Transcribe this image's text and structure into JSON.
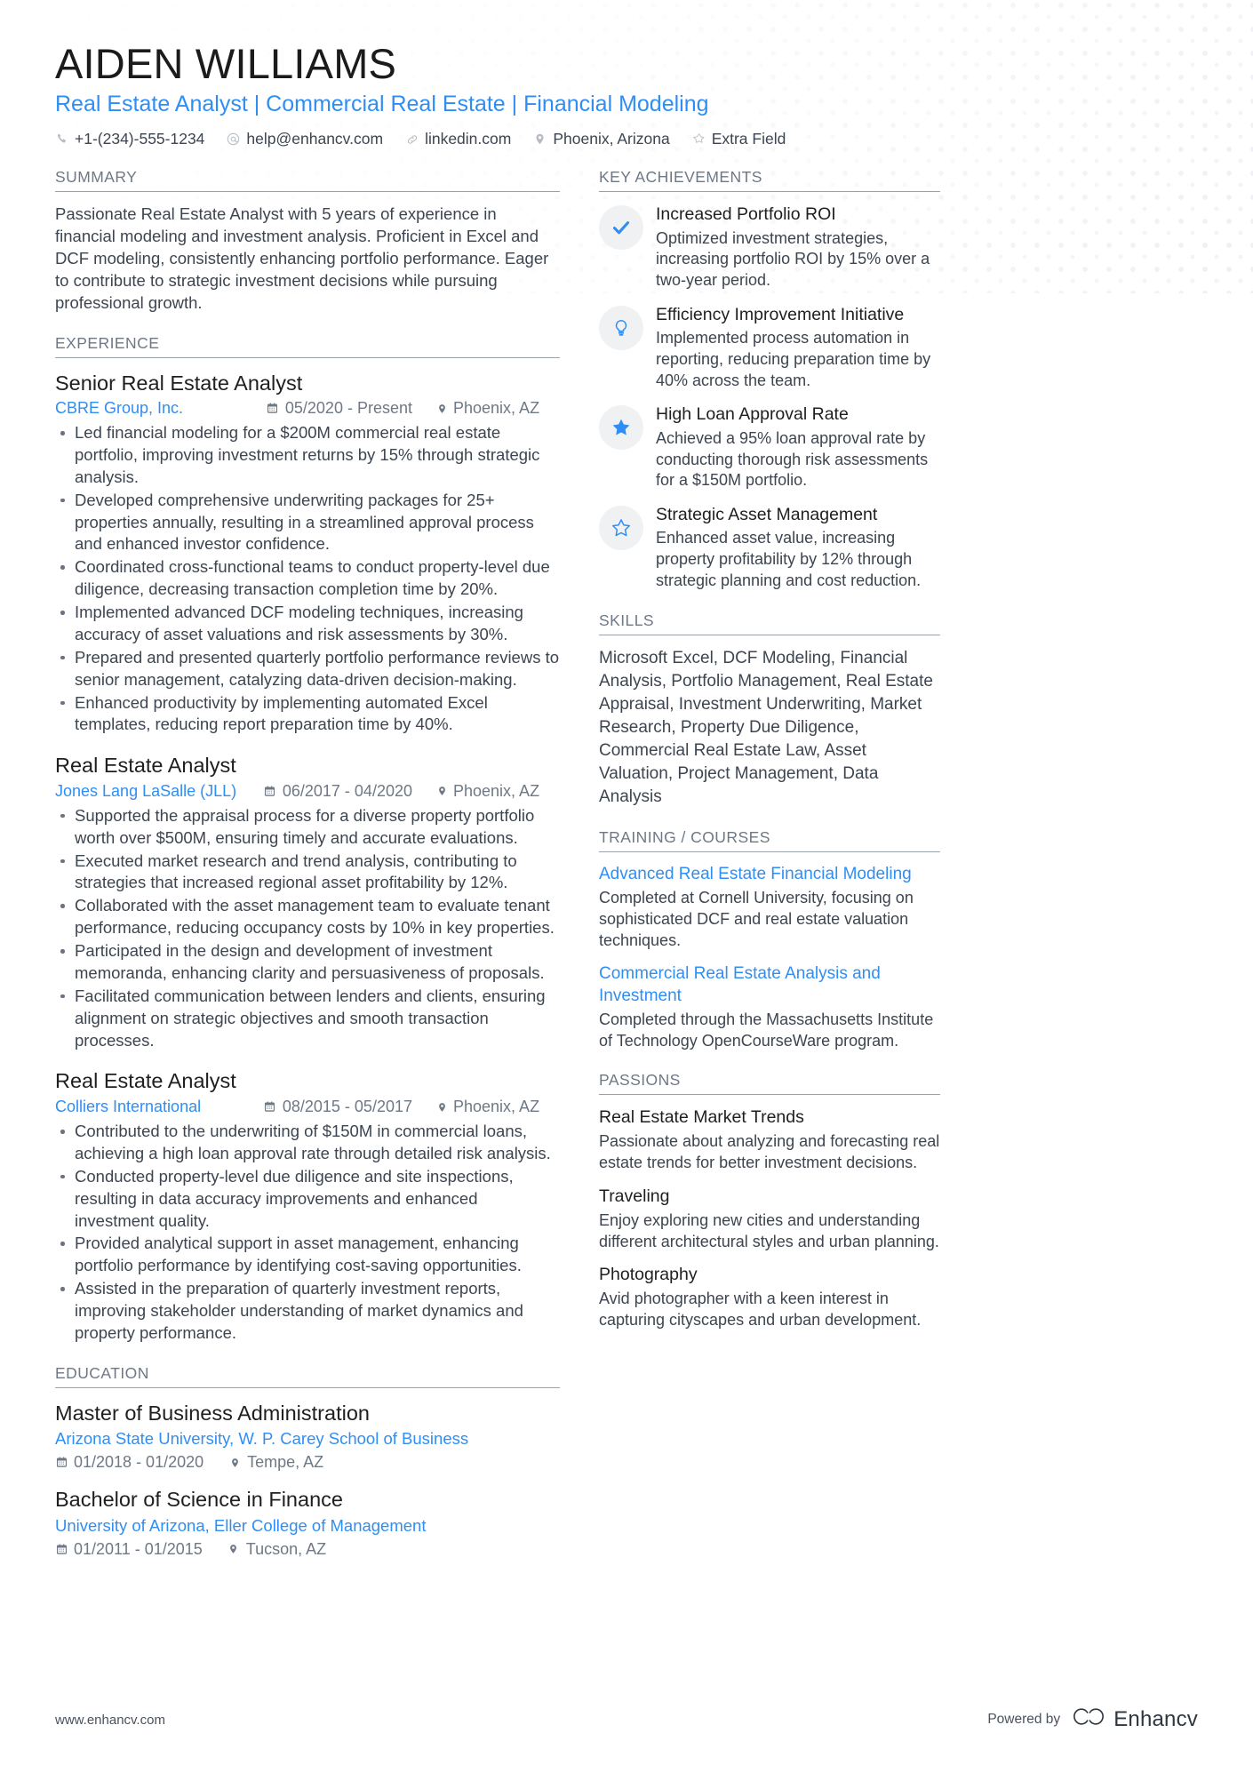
{
  "header": {
    "name": "AIDEN WILLIAMS",
    "headline": "Real Estate Analyst | Commercial Real Estate | Financial Modeling",
    "contacts": [
      {
        "icon": "phone-icon",
        "text": "+1-(234)-555-1234"
      },
      {
        "icon": "email-icon",
        "text": "help@enhancv.com"
      },
      {
        "icon": "link-icon",
        "text": "linkedin.com"
      },
      {
        "icon": "location-pin-icon",
        "text": "Phoenix, Arizona"
      },
      {
        "icon": "star-outline-icon",
        "text": "Extra Field"
      }
    ]
  },
  "sections": {
    "summary_title": "SUMMARY",
    "experience_title": "EXPERIENCE",
    "education_title": "EDUCATION",
    "key_achievements_title": "KEY ACHIEVEMENTS",
    "skills_title": "SKILLS",
    "training_title": "TRAINING / COURSES",
    "passions_title": "PASSIONS"
  },
  "summary": {
    "text": "Passionate Real Estate Analyst with 5 years of experience in financial modeling and investment analysis. Proficient in Excel and DCF modeling, consistently enhancing portfolio performance. Eager to contribute to strategic investment decisions while pursuing professional growth."
  },
  "experience": [
    {
      "title": "Senior Real Estate Analyst",
      "company": "CBRE Group, Inc.",
      "date": "05/2020 - Present",
      "location": "Phoenix, AZ",
      "bullets": [
        "Led financial modeling for a $200M commercial real estate portfolio, improving investment returns by 15% through strategic analysis.",
        "Developed comprehensive underwriting packages for 25+ properties annually, resulting in a streamlined approval process and enhanced investor confidence.",
        "Coordinated cross-functional teams to conduct property-level due diligence, decreasing transaction completion time by 20%.",
        "Implemented advanced DCF modeling techniques, increasing accuracy of asset valuations and risk assessments by 30%.",
        "Prepared and presented quarterly portfolio performance reviews to senior management, catalyzing data-driven decision-making.",
        "Enhanced productivity by implementing automated Excel templates, reducing report preparation time by 40%."
      ]
    },
    {
      "title": "Real Estate Analyst",
      "company": "Jones Lang LaSalle (JLL)",
      "date": "06/2017 - 04/2020",
      "location": "Phoenix, AZ",
      "bullets": [
        "Supported the appraisal process for a diverse property portfolio worth over $500M, ensuring timely and accurate evaluations.",
        "Executed market research and trend analysis, contributing to strategies that increased regional asset profitability by 12%.",
        "Collaborated with the asset management team to evaluate tenant performance, reducing occupancy costs by 10% in key properties.",
        "Participated in the design and development of investment memoranda, enhancing clarity and persuasiveness of proposals.",
        "Facilitated communication between lenders and clients, ensuring alignment on strategic objectives and smooth transaction processes."
      ]
    },
    {
      "title": "Real Estate Analyst",
      "company": "Colliers International",
      "date": "08/2015 - 05/2017",
      "location": "Phoenix, AZ",
      "bullets": [
        "Contributed to the underwriting of $150M in commercial loans, achieving a high loan approval rate through detailed risk analysis.",
        "Conducted property-level due diligence and site inspections, resulting in data accuracy improvements and enhanced investment quality.",
        "Provided analytical support in asset management, enhancing portfolio performance by identifying cost-saving opportunities.",
        "Assisted in the preparation of quarterly investment reports, improving stakeholder understanding of market dynamics and property performance."
      ]
    }
  ],
  "education": [
    {
      "degree": "Master of Business Administration",
      "school": "Arizona State University, W. P. Carey School of Business",
      "date": "01/2018 - 01/2020",
      "location": "Tempe, AZ"
    },
    {
      "degree": "Bachelor of Science in Finance",
      "school": "University of Arizona, Eller College of Management",
      "date": "01/2011 - 01/2015",
      "location": "Tucson, AZ"
    }
  ],
  "key_achievements": [
    {
      "icon": "check-icon",
      "title": "Increased Portfolio ROI",
      "description": "Optimized investment strategies, increasing portfolio ROI by 15% over a two-year period."
    },
    {
      "icon": "lightbulb-icon",
      "title": "Efficiency Improvement Initiative",
      "description": "Implemented process automation in reporting, reducing preparation time by 40% across the team."
    },
    {
      "icon": "star-filled-icon",
      "title": "High Loan Approval Rate",
      "description": "Achieved a 95% loan approval rate by conducting thorough risk assessments for a $150M portfolio."
    },
    {
      "icon": "star-outline-icon",
      "title": "Strategic Asset Management",
      "description": "Enhanced asset value, increasing property profitability by 12% through strategic planning and cost reduction."
    }
  ],
  "skills": {
    "text": "Microsoft Excel, DCF Modeling, Financial Analysis, Portfolio Management, Real Estate Appraisal, Investment Underwriting, Market Research, Property Due Diligence, Commercial Real Estate Law, Asset Valuation, Project Management, Data Analysis"
  },
  "training": [
    {
      "title": "Advanced Real Estate Financial Modeling",
      "description": "Completed at Cornell University, focusing on sophisticated DCF and real estate valuation techniques."
    },
    {
      "title": "Commercial Real Estate Analysis and Investment",
      "description": "Completed through the Massachusetts Institute of Technology OpenCourseWare program."
    }
  ],
  "passions": [
    {
      "title": "Real Estate Market Trends",
      "description": "Passionate about analyzing and forecasting real estate trends for better investment decisions."
    },
    {
      "title": "Traveling",
      "description": "Enjoy exploring new cities and understanding different architectural styles and urban planning."
    },
    {
      "title": "Photography",
      "description": "Avid photographer with a keen interest in capturing cityscapes and urban development."
    }
  ],
  "footer": {
    "url": "www.enhancv.com",
    "powered_by": "Powered by",
    "brand": "Enhancv"
  },
  "colors": {
    "accent": "#2f8ef4",
    "text": "#3d4550",
    "heading": "#1f1f1f",
    "muted": "#6f7885",
    "badge_bg": "#f0f1f2"
  }
}
